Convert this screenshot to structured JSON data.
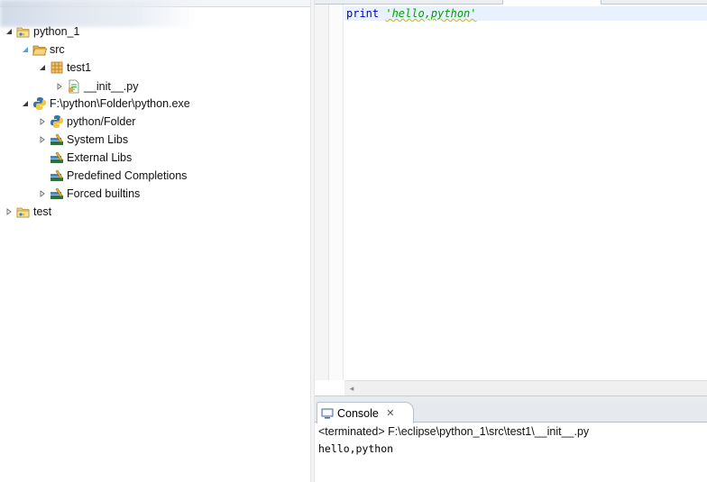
{
  "explorer": {
    "items": [
      {
        "label": "python_1",
        "expanded": true,
        "icon": "project-folder-icon"
      },
      {
        "label": "src",
        "expanded": true,
        "icon": "source-folder-icon"
      },
      {
        "label": "test1",
        "expanded": true,
        "icon": "package-icon"
      },
      {
        "label": "__init__.py",
        "expanded": false,
        "icon": "python-file-icon"
      },
      {
        "label": "F:\\python\\Folder\\python.exe",
        "expanded": true,
        "icon": "python-interpreter-icon"
      },
      {
        "label": "python/Folder",
        "expanded": false,
        "icon": "python-interpreter-icon"
      },
      {
        "label": "System Libs",
        "expanded": false,
        "icon": "library-icon"
      },
      {
        "label": "External Libs",
        "expanded": null,
        "icon": "library-icon"
      },
      {
        "label": "Predefined Completions",
        "expanded": null,
        "icon": "library-icon"
      },
      {
        "label": "Forced builtins",
        "expanded": false,
        "icon": "library-icon"
      },
      {
        "label": "test",
        "expanded": false,
        "icon": "project-folder-icon"
      }
    ]
  },
  "editor": {
    "code": {
      "keyword": "print",
      "string": "'hello,python'"
    }
  },
  "console": {
    "tab_label": "Console",
    "tab_icon": "console-icon",
    "status": "<terminated> F:\\eclipse\\python_1\\src\\test1\\__init__.py",
    "output": "hello,python"
  },
  "colors": {
    "keyword": "#0000c0",
    "string": "#00a000",
    "current_line": "#e8f2fe"
  }
}
